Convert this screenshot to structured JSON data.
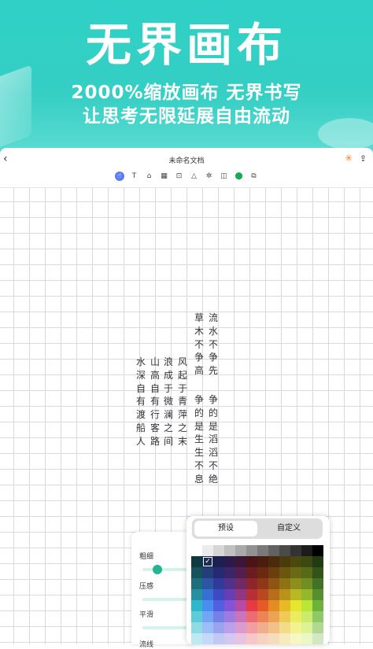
{
  "banner": {
    "title": "无界画布",
    "subtitle_line1": "2000%缩放画布 无界书写",
    "subtitle_line2": "让思考无限延展自由流动"
  },
  "topbar": {
    "back_icon": "‹",
    "document_title": "未命名文档",
    "sun_icon": "✳",
    "share_icon": "⇪"
  },
  "toolbar": {
    "tools": [
      {
        "name": "hand-tool",
        "glyph": "☝"
      },
      {
        "name": "text-tool",
        "glyph": "T"
      },
      {
        "name": "image-tool",
        "glyph": "⌂"
      },
      {
        "name": "table-tool",
        "glyph": "▦"
      },
      {
        "name": "scan-tool",
        "glyph": "⊡"
      },
      {
        "name": "shape-tool",
        "glyph": "△"
      },
      {
        "name": "magic-tool",
        "glyph": "✲"
      },
      {
        "name": "sticky-note-tool",
        "glyph": "◫"
      },
      {
        "name": "location-tool",
        "glyph": "⬤"
      },
      {
        "name": "layers-tool",
        "glyph": "⧉"
      }
    ]
  },
  "calligraphy": {
    "columns": [
      "流水不争先",
      "争的是滔滔不绝",
      "草木不争高",
      "争的是生生不息",
      "风起于青萍之末",
      "浪成于微澜之间",
      "山高自有行客路",
      "水深自有渡船人"
    ]
  },
  "pen_panel": {
    "labels": [
      "粗细",
      "压感",
      "平滑",
      "流线"
    ]
  },
  "color_panel": {
    "preset_tab": "预设",
    "custom_tab": "自定义",
    "check_glyph": "✓",
    "selected_color": "#1c2b55",
    "colors": [
      "#ffffff",
      "#ececec",
      "#d6d6d6",
      "#c0c0c0",
      "#a9a9a9",
      "#929292",
      "#7a7a7a",
      "#626262",
      "#4a4a4a",
      "#333333",
      "#1c1c1c",
      "#000000",
      "#0f3a40",
      "#1c2b55",
      "#1c1f4f",
      "#2b1a4a",
      "#3b1636",
      "#4a1417",
      "#4a1d0d",
      "#4a2b0a",
      "#4a3c0a",
      "#4a4a0e",
      "#3c4a10",
      "#233b13",
      "#16525b",
      "#233e7a",
      "#252a72",
      "#3c2568",
      "#541f4c",
      "#6a1c20",
      "#6a2a12",
      "#6a3e0e",
      "#6a560e",
      "#6a6a14",
      "#566a18",
      "#32541b",
      "#1c6f7a",
      "#2c55a3",
      "#313a98",
      "#50328b",
      "#712a66",
      "#8e252b",
      "#8e3818",
      "#8e5414",
      "#8e7314",
      "#8e8e1c",
      "#728e22",
      "#437125",
      "#2490a0",
      "#386fd4",
      "#3d4ac2",
      "#6640b2",
      "#923682",
      "#b83037",
      "#b8481f",
      "#b86d1a",
      "#b8951a",
      "#b8b824",
      "#94b82c",
      "#578f30",
      "#2eb6c9",
      "#4a8cf0",
      "#5060e0",
      "#8355d6",
      "#b74aa4",
      "#e63b44",
      "#e65a27",
      "#e68a22",
      "#e6ba22",
      "#e6e62e",
      "#b9e638",
      "#6cb33c",
      "#5ecbda",
      "#73a5f3",
      "#7481e7",
      "#9f7ae0",
      "#cb74b9",
      "#ec6c73",
      "#ec8458",
      "#eca454",
      "#eccc54",
      "#ecec60",
      "#cbec68",
      "#8fc866",
      "#8edbe5",
      "#9cbef6",
      "#9aa4ee",
      "#bba1e9",
      "#da9cce",
      "#f29da1",
      "#f2ae8c",
      "#f2c187",
      "#f2dc87",
      "#f2f290",
      "#dcf295",
      "#b0d894",
      "#bdeaf0",
      "#c5d8f9",
      "#c1c8f4",
      "#d6c7f2",
      "#e8c3e1",
      "#f7c6c9",
      "#f7d2c0",
      "#f7dcbc",
      "#f7ebbc",
      "#f7f7c2",
      "#ebf7c6",
      "#d1e8c3"
    ]
  }
}
